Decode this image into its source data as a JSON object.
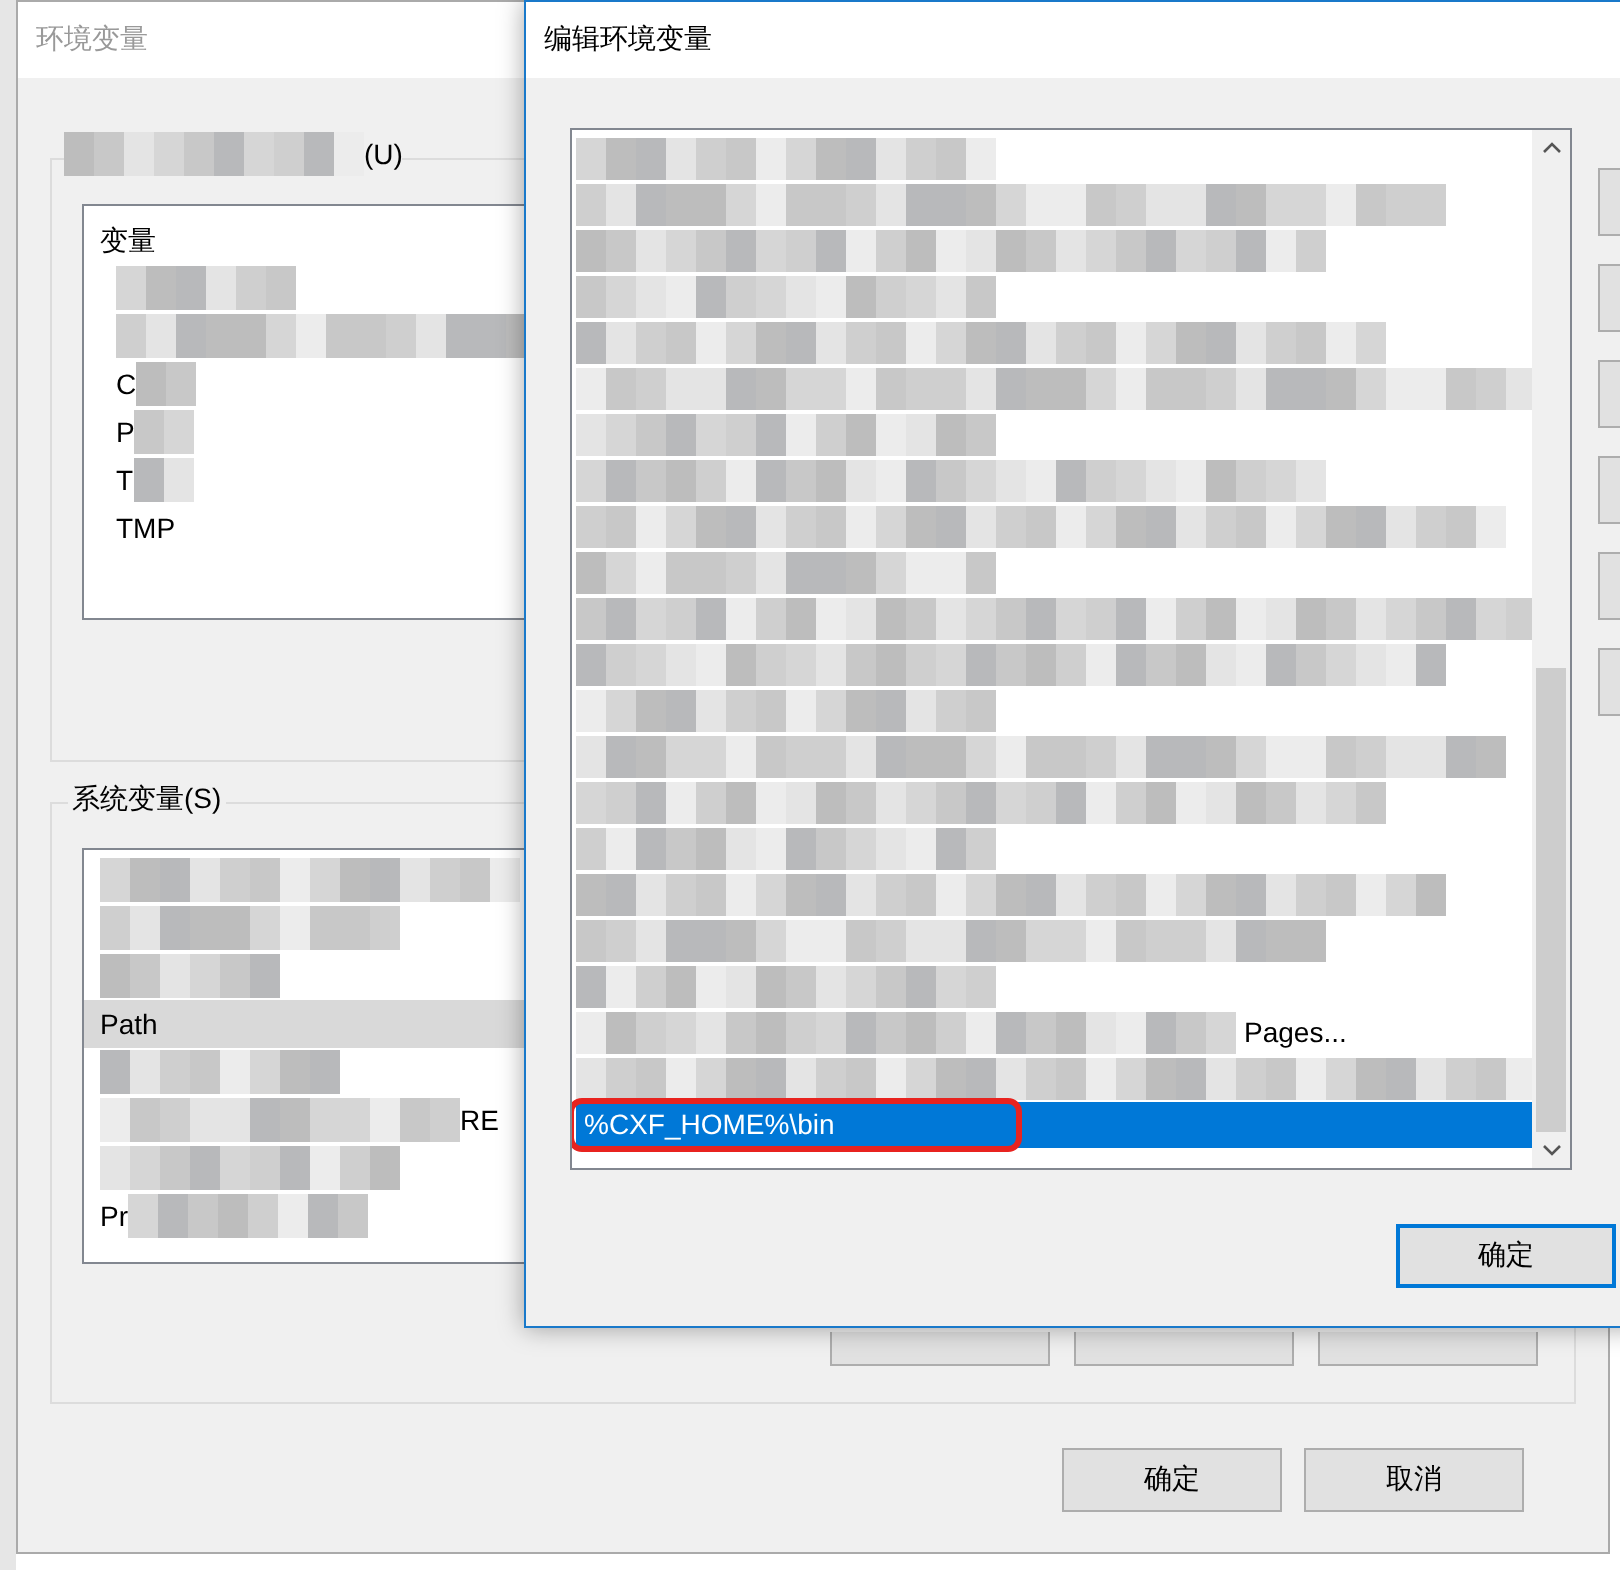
{
  "env_window": {
    "title": "环境变量",
    "active": false,
    "user_vars": {
      "label": "(U)",
      "header": "变量",
      "rows": [
        {
          "kind": "blurred"
        },
        {
          "kind": "blurred"
        },
        {
          "kind": "partial",
          "text": "C"
        },
        {
          "kind": "partial",
          "text": "P"
        },
        {
          "kind": "partial",
          "text": "T"
        },
        {
          "kind": "text",
          "text": "TMP"
        }
      ]
    },
    "system_vars": {
      "label": "系统变量(S)",
      "rows": [
        {
          "kind": "blurred",
          "selected": false
        },
        {
          "kind": "blurred",
          "selected": false
        },
        {
          "kind": "blurred",
          "selected": false
        },
        {
          "kind": "text",
          "text": "Path",
          "selected": true
        },
        {
          "kind": "blurred",
          "selected": false
        },
        {
          "kind": "partial-end",
          "text": "RE",
          "selected": false
        },
        {
          "kind": "blurred",
          "selected": false
        },
        {
          "kind": "partial",
          "text": "Pr",
          "selected": false
        }
      ]
    },
    "buttons": [
      "确定",
      "取消"
    ]
  },
  "edit_dialog": {
    "title": "编辑环境变量",
    "active": true,
    "rows": [
      {
        "kind": "blurred",
        "selected": false
      },
      {
        "kind": "blurred",
        "selected": false
      },
      {
        "kind": "blurred",
        "selected": false
      },
      {
        "kind": "blurred",
        "selected": false
      },
      {
        "kind": "blurred",
        "selected": false
      },
      {
        "kind": "blurred",
        "selected": false
      },
      {
        "kind": "blurred",
        "selected": false
      },
      {
        "kind": "blurred",
        "selected": false
      },
      {
        "kind": "blurred",
        "selected": false
      },
      {
        "kind": "blurred",
        "selected": false
      },
      {
        "kind": "blurred",
        "selected": false
      },
      {
        "kind": "blurred",
        "selected": false
      },
      {
        "kind": "blurred",
        "selected": false
      },
      {
        "kind": "blurred",
        "selected": false
      },
      {
        "kind": "blurred",
        "selected": false
      },
      {
        "kind": "blurred",
        "selected": false
      },
      {
        "kind": "blurred",
        "selected": false
      },
      {
        "kind": "blurred",
        "selected": false
      },
      {
        "kind": "blurred",
        "selected": false
      },
      {
        "kind": "partial-end",
        "text": "Pages...",
        "selected": false
      },
      {
        "kind": "blurred",
        "selected": false
      },
      {
        "kind": "text",
        "text": "%CXF_HOME%\\bin",
        "selected": true,
        "highlighted": true
      }
    ],
    "ok_button": "确定"
  }
}
